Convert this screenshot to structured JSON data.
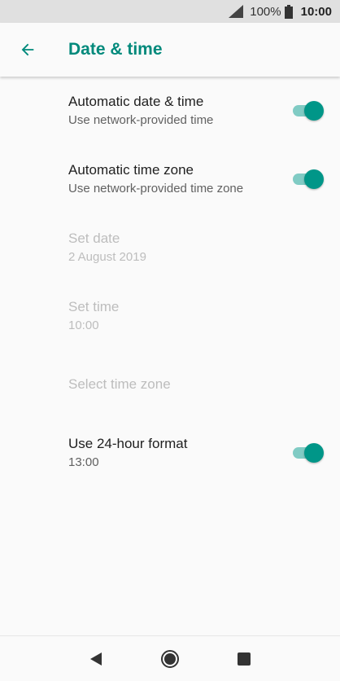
{
  "status_bar": {
    "battery_percent": "100%",
    "time": "10:00",
    "icons": [
      "signal-icon",
      "battery-icon"
    ]
  },
  "app_bar": {
    "title": "Date & time",
    "back_icon": "arrow-left-icon"
  },
  "colors": {
    "accent": "#009688",
    "title": "#00897b",
    "track": "#80cbc4",
    "disabled_text": "#bdbdbd"
  },
  "settings": {
    "auto_date_time": {
      "title": "Automatic date & time",
      "summary": "Use network-provided time",
      "enabled": true
    },
    "auto_time_zone": {
      "title": "Automatic time zone",
      "summary": "Use network-provided time zone",
      "enabled": true
    },
    "set_date": {
      "title": "Set date",
      "summary": "2 August 2019"
    },
    "set_time": {
      "title": "Set time",
      "summary": "10:00"
    },
    "select_time_zone": {
      "title": "Select time zone"
    },
    "use_24_hour": {
      "title": "Use 24-hour format",
      "summary": "13:00",
      "enabled": true
    }
  },
  "nav_bar": {
    "icons": [
      "back-triangle-icon",
      "home-circle-icon",
      "recents-square-icon"
    ]
  }
}
